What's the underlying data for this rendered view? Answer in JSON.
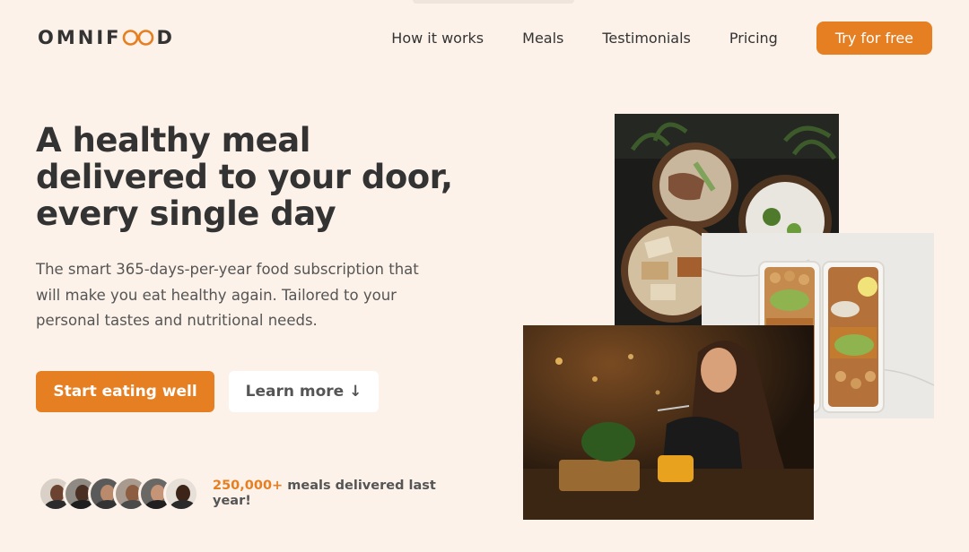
{
  "header": {
    "logo_left": "OMNIF",
    "logo_right": "D",
    "nav": [
      "How it works",
      "Meals",
      "Testimonials",
      "Pricing"
    ],
    "cta": "Try for free"
  },
  "hero": {
    "title": "A healthy meal delivered to your door, every single day",
    "description": "The smart 365-days-per-year food subscription that will make you eat healthy again. Tailored to your personal tastes and nutritional needs.",
    "primary_button": "Start eating well",
    "secondary_button": "Learn more ↓",
    "delivered_count": "250,000+",
    "delivered_text": "meals delivered last year!"
  },
  "colors": {
    "accent": "#e67e22",
    "background": "#fdf2e9",
    "text": "#333333"
  },
  "icons": [
    "infinity-logo-icon",
    "down-arrow-icon"
  ]
}
